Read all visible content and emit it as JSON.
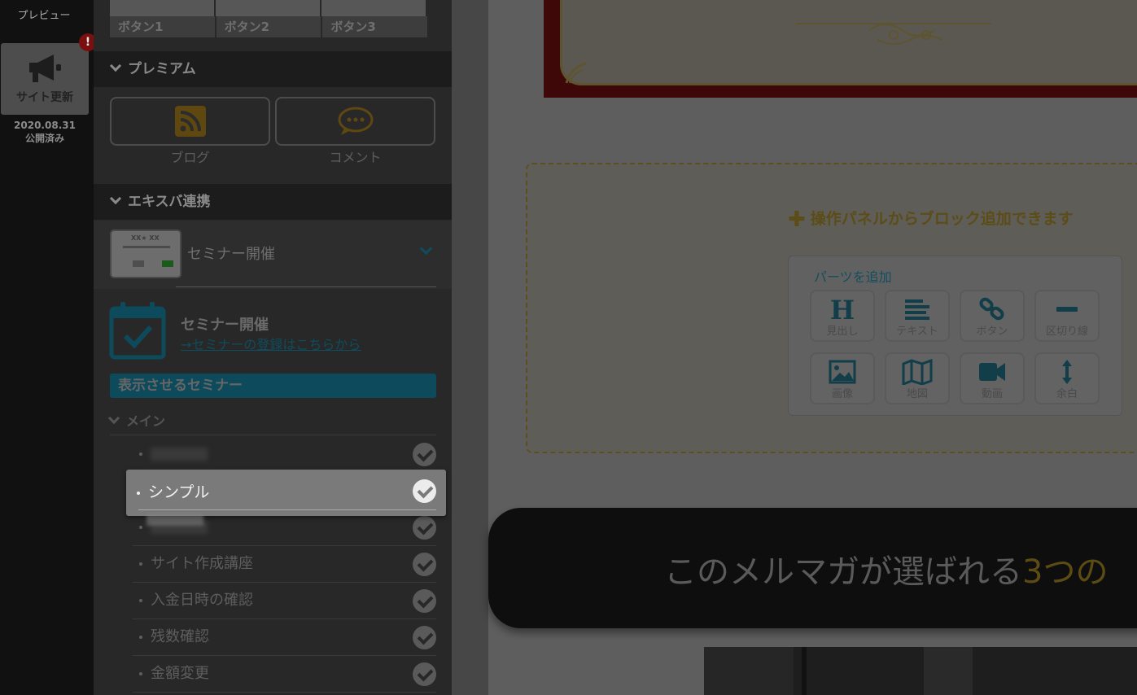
{
  "rail": {
    "preview_label": "プレビュー",
    "update_label": "サイト更新",
    "alert_mark": "!",
    "update_date": "2020.08.31",
    "update_status": "公開済み"
  },
  "panel": {
    "buttons": [
      "ボタン1",
      "ボタン2",
      "ボタン3"
    ],
    "premium": {
      "title": "プレミアム",
      "items": [
        {
          "label": "ブログ",
          "icon": "rss-icon"
        },
        {
          "label": "コメント",
          "icon": "comment-icon"
        }
      ]
    },
    "xserver": {
      "title": "エキスバ連携",
      "seminar_name": "セミナー開催",
      "thumb_title": "XX★ XX"
    },
    "seminar": {
      "title": "セミナー開催",
      "link": "→セミナーの登録はこちらから",
      "show_label": "表示させるセミナー",
      "group_label": "メイン",
      "items": [
        {
          "label": "",
          "checked": true,
          "blurred": true
        },
        {
          "label": "シンプル",
          "checked": true,
          "selected": true
        },
        {
          "label": "",
          "checked": true,
          "blurred": true
        },
        {
          "label": "サイト作成講座",
          "checked": true
        },
        {
          "label": "入金日時の確認",
          "checked": true
        },
        {
          "label": "残数確認",
          "checked": true
        },
        {
          "label": "金額変更",
          "checked": true
        }
      ]
    }
  },
  "canvas": {
    "drop_message": "操作パネルからブロック追加できます",
    "parts_title": "パーツを追加",
    "parts": [
      {
        "label": "見出し",
        "icon": "heading-icon"
      },
      {
        "label": "テキスト",
        "icon": "text-icon"
      },
      {
        "label": "ボタン",
        "icon": "link-icon"
      },
      {
        "label": "区切り線",
        "icon": "divider-icon"
      },
      {
        "label": "画像",
        "icon": "image-icon"
      },
      {
        "label": "地図",
        "icon": "map-icon"
      },
      {
        "label": "動画",
        "icon": "video-icon"
      },
      {
        "label": "余白",
        "icon": "spacing-icon"
      }
    ],
    "banner_text_prefix": "このメルマガが選ばれる",
    "banner_text_number": "3",
    "banner_text_suffix": "つの"
  },
  "colors": {
    "accent_teal": "#0d4b5c",
    "accent_gold": "#5c4c18",
    "alert_red": "#7a0f0f"
  }
}
